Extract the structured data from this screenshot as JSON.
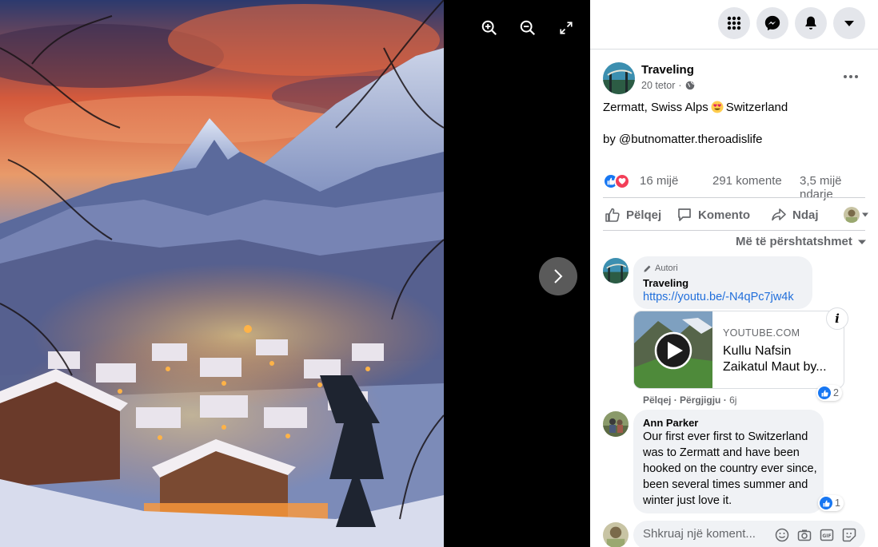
{
  "viewer": {
    "tools": [
      "zoom-in-icon",
      "zoom-out-icon",
      "fullscreen-icon"
    ],
    "next": "chevron-right-icon",
    "photo": "Snowy alpine village at dusk below a mountain peak"
  },
  "topbar": {
    "buttons": [
      "menu-grid-icon",
      "messenger-icon",
      "notifications-bell-icon",
      "account-caret-icon"
    ]
  },
  "post": {
    "author": "Traveling",
    "date": "20 tetor",
    "separator": "·",
    "audience_icon": "globe-icon",
    "text_line1_a": "Zermatt, Swiss Alps",
    "text_line1_emoji": "heart-eyes-emoji",
    "text_line1_b": "Switzerland",
    "text_line2": "by @butnomatter.theroadislife",
    "reactions": [
      "like",
      "love"
    ],
    "reaction_count": "16 mijë",
    "comments_count": "291 komente",
    "shares_count": "3,5 mijë ndarje"
  },
  "actions": {
    "like": "Pëlqej",
    "comment": "Komento",
    "share": "Ndaj"
  },
  "sort_label": "Më të përshtatshmet",
  "comments": [
    {
      "badge": "Autori",
      "name": "Traveling",
      "link": "https://youtu.be/-N4qPc7jw4k",
      "card": {
        "domain": "YOUTUBE.COM",
        "title": "Kullu Nafsin Zaikatul Maut by..."
      },
      "like_action": "Pëlqej",
      "reply_action": "Përgjigju",
      "dot": "·",
      "time": "6j",
      "likes": "2"
    },
    {
      "name": "Ann Parker",
      "text": "Our first ever first to Switzerland was to Zermatt and have been hooked on the country ever since, been several times summer and winter just love it.",
      "likes": "1"
    }
  ],
  "composer": {
    "placeholder": "Shkruaj një koment...",
    "icons": [
      "emoji-icon",
      "camera-icon",
      "gif-icon",
      "sticker-icon"
    ]
  },
  "colors": {
    "accent": "#1877f2",
    "love": "#f33e58",
    "bubble": "#f0f2f5",
    "secondary_text": "#65676b"
  }
}
